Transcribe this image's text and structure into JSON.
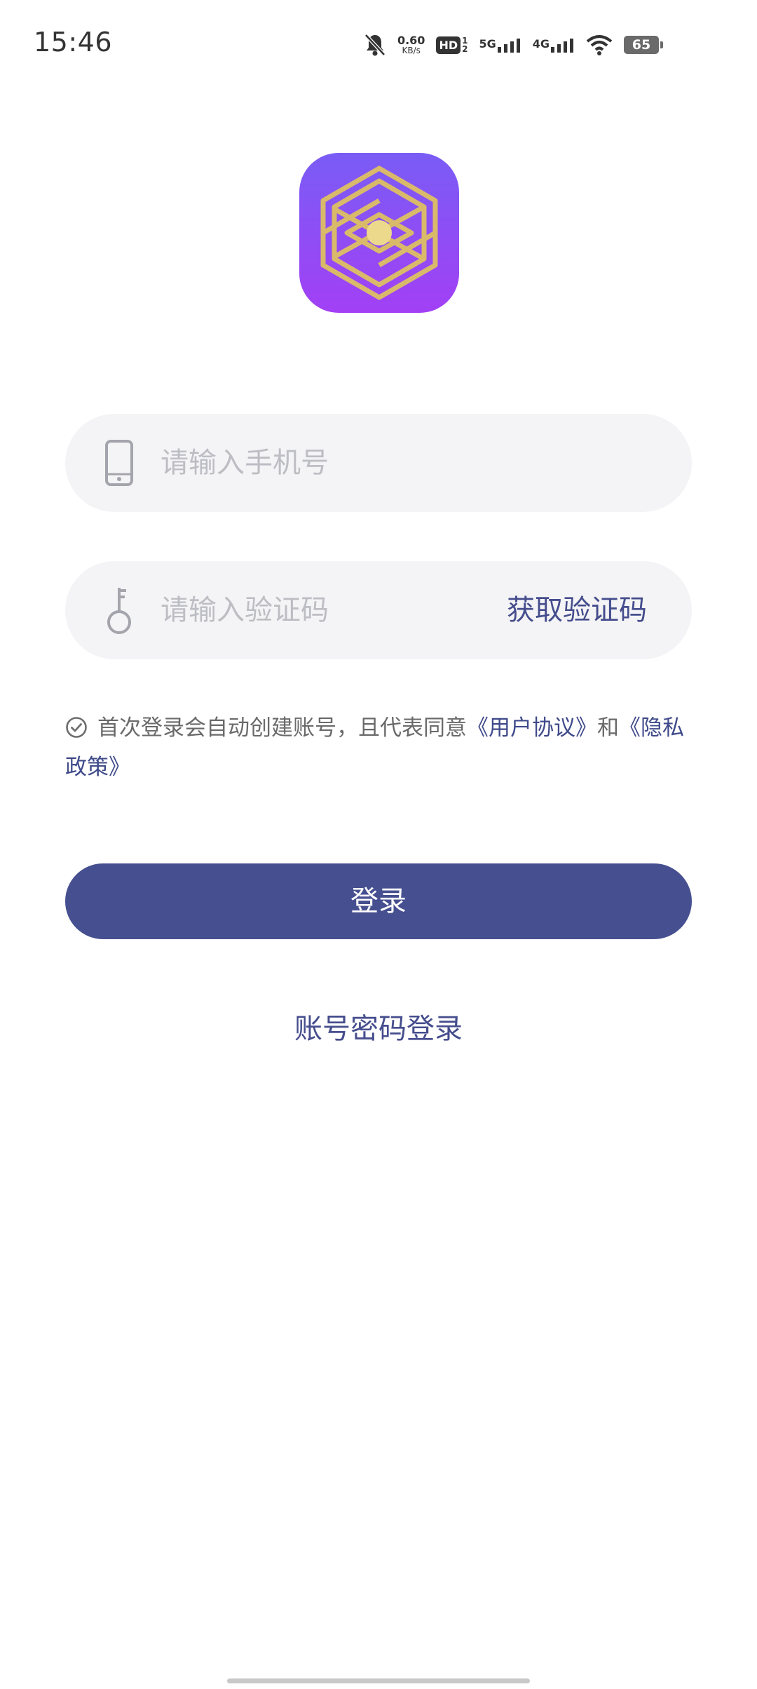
{
  "status_bar": {
    "time": "15:46",
    "net_speed_value": "0.60",
    "net_speed_unit": "KB/s",
    "hd_label": "HD",
    "hd_sim1": "1",
    "hd_sim2": "2",
    "sim1_network": "5G",
    "sim2_network": "4G",
    "battery_level": "65",
    "icons": [
      "mute-bell-icon",
      "hd-icon",
      "signal-icon",
      "wifi-icon",
      "battery-icon"
    ]
  },
  "logo": {
    "icon": "hexagon-eye-logo",
    "gradient_top": "#7a5cf5",
    "gradient_bottom": "#a240f5",
    "accent_gold": "#d9b96a"
  },
  "phone_field": {
    "placeholder": "请输入手机号",
    "value": "",
    "icon": "phone-icon"
  },
  "code_field": {
    "placeholder": "请输入验证码",
    "value": "",
    "icon": "key-icon",
    "get_code_label": "获取验证码"
  },
  "agreement": {
    "prefix": "首次登录会自动创建账号，且代表同意",
    "user_agreement": "《用户协议》",
    "connector": "和",
    "privacy_policy": "《隐私政策》"
  },
  "login_button": {
    "label": "登录",
    "color": "#464f8f"
  },
  "password_login": {
    "label": "账号密码登录"
  }
}
